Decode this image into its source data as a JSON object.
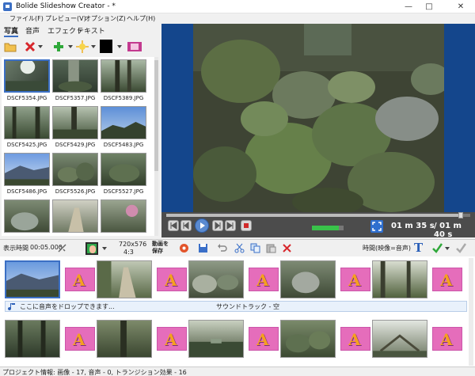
{
  "window": {
    "title": "Bolide Slideshow Creator - *",
    "minimize": "—",
    "maximize": "□",
    "close": "✕"
  },
  "menu": {
    "items": [
      "ファイル(F)",
      "プレビュー(V)",
      "オプション(Z)",
      "ヘルプ(H)"
    ]
  },
  "tabs": [
    "写真",
    "音声",
    "エフェクト",
    "テキスト"
  ],
  "gallery": {
    "thumbnails": [
      {
        "label": "DSCF5354.JPG",
        "selected": true
      },
      {
        "label": "DSCF5357.JPG"
      },
      {
        "label": "DSCF5389.JPG"
      },
      {
        "label": "DSCF5425.JPG"
      },
      {
        "label": "DSCF5429.JPG"
      },
      {
        "label": "DSCF5483.JPG"
      },
      {
        "label": "DSCF5486.JPG"
      },
      {
        "label": "DSCF5526.JPG"
      },
      {
        "label": "DSCF5527.JPG"
      },
      {
        "label": ""
      },
      {
        "label": ""
      },
      {
        "label": ""
      }
    ]
  },
  "player": {
    "progress_fraction": 0.97,
    "current_time": "01 m 35 s",
    "total_time": "/ 01 m 40 s",
    "volume_fraction": 0.85
  },
  "controls": {
    "duration_label": "表示時間",
    "duration_value": "00:05.000",
    "resolution": "720x576",
    "aspect": "4:3",
    "save_video": "動画を保存",
    "time_mode": "時間(映像=音声)"
  },
  "storyboard": {
    "sound_hint": "ここに音声をドロップできます...",
    "soundtrack_label": "サウンドトラック - 空",
    "transition_glyph": "A"
  },
  "status": {
    "text": "プロジェクト情報: 画像 - 17, 音声 - 0, トランジション効果 - 16"
  },
  "icons": {
    "accent": "#3b6fc4",
    "preview_bg": "#14468c",
    "player_bg": "#4c4c4c",
    "transition_pink": "#e56dbb"
  }
}
